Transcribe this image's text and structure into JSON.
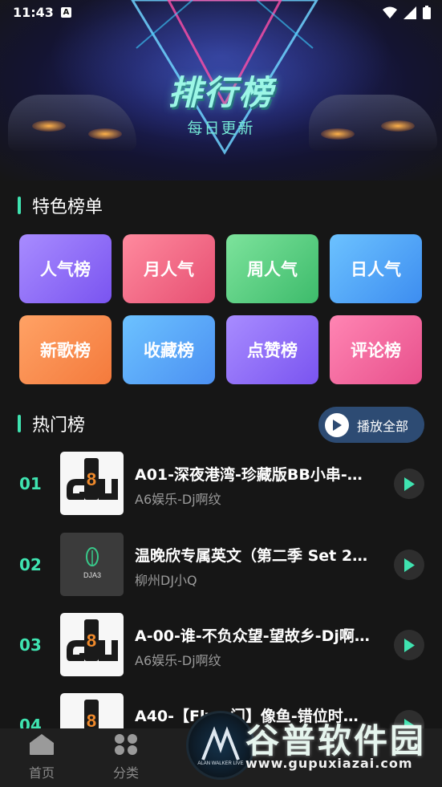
{
  "status_bar": {
    "time": "11:43",
    "notif_icon": "A"
  },
  "hero": {
    "title": "排行榜",
    "subtitle": "每日更新"
  },
  "featured": {
    "heading": "特色榜单",
    "tiles": [
      "人气榜",
      "月人气",
      "周人气",
      "日人气",
      "新歌榜",
      "收藏榜",
      "点赞榜",
      "评论榜"
    ]
  },
  "hot": {
    "heading": "热门榜",
    "play_all": "播放全部",
    "songs": [
      {
        "rank": "01",
        "title": "A01-深夜港湾-珍藏版BB小串-…",
        "artist": "A6娱乐-Dj啊纹",
        "cover": "A6"
      },
      {
        "rank": "02",
        "title": "温晚欣专属英文（第二季 Set 2…",
        "artist": "柳州DJ小Q",
        "cover": "DJA3"
      },
      {
        "rank": "03",
        "title": "A-00-谁-不负众望-望故乡-Dj啊…",
        "artist": "A6娱乐-Dj啊纹",
        "cover": "A6"
      },
      {
        "rank": "04",
        "title": "A40-【Fly…门】像鱼-错位时…",
        "artist": "",
        "cover": "A6"
      }
    ]
  },
  "bottom_nav": {
    "home": "首页",
    "category": "分类"
  },
  "now_playing": {
    "cover_text": "ALAN WALKER LIVE"
  },
  "watermark": {
    "main": "谷普软件园",
    "url": "www.gupuxiazai.com"
  }
}
